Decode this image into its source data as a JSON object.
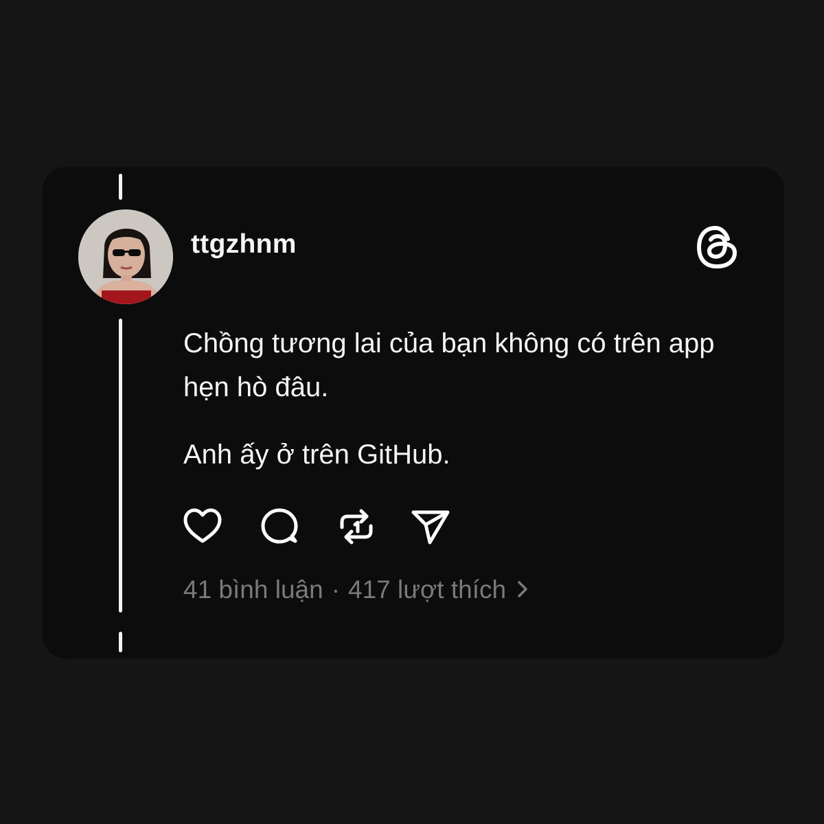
{
  "post": {
    "username": "ttgzhnm",
    "text_paragraph_1": "Chồng tương lai của bạn không có trên app hẹn hò đâu.",
    "text_paragraph_2": "Anh ấy ở trên GitHub.",
    "comments_text": "41 bình luận",
    "separator": "·",
    "likes_text": "417 lượt thích"
  },
  "icons": {
    "brand": "threads-logo-icon",
    "like": "heart-icon",
    "comment": "comment-bubble-icon",
    "repost": "repost-icon",
    "share": "send-icon",
    "more": "chevron-right-icon"
  },
  "colors": {
    "background": "#151515",
    "card": "#0c0c0c",
    "text_primary": "#f5f5f5",
    "text_secondary": "#7a7a7a"
  }
}
